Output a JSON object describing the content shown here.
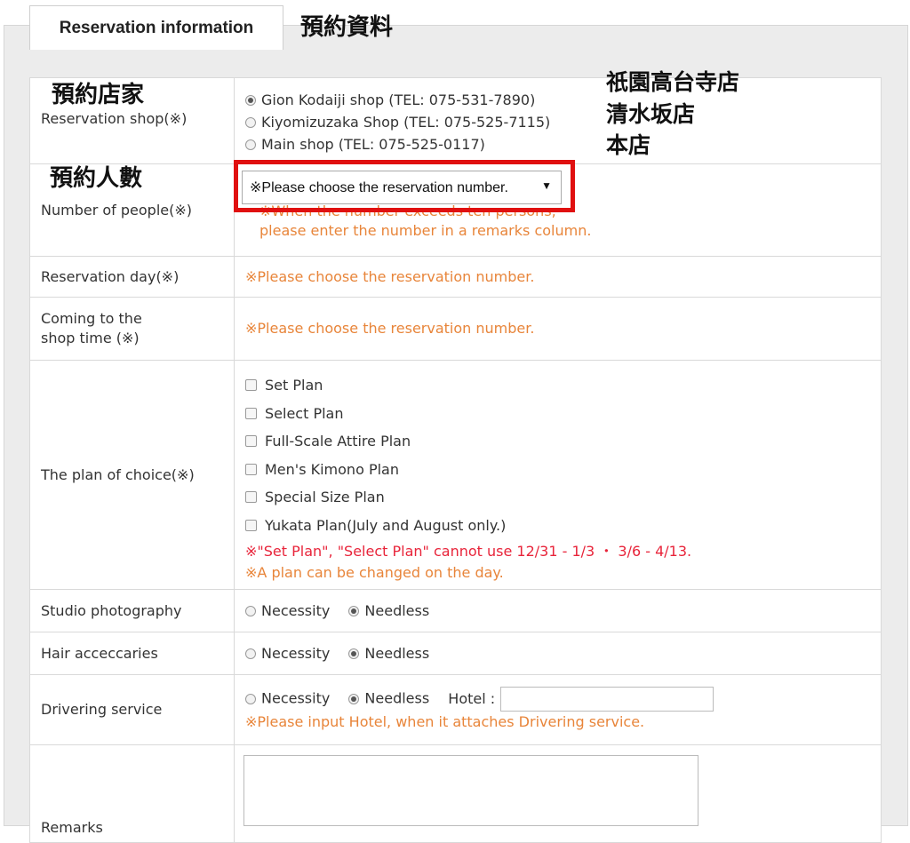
{
  "tab": {
    "label": "Reservation information",
    "cn": "預約資料"
  },
  "annotations": {
    "shop": "預約店家",
    "people": "預約人數",
    "shop_names": [
      "祇園高台寺店",
      "清水坂店",
      "本店"
    ]
  },
  "rows": {
    "shop": {
      "label": "Reservation shop(※)",
      "options": [
        {
          "text": "Gion Kodaiji shop (TEL: 075-531-7890)",
          "selected": true
        },
        {
          "text": "Kiyomizuzaka Shop (TEL: 075-525-7115)",
          "selected": false
        },
        {
          "text": "Main shop (TEL: 075-525-0117)",
          "selected": false
        }
      ]
    },
    "people": {
      "label": "Number of people(※)",
      "select_value": "※Please choose the reservation number.",
      "note1": "※When the number exceeds ten persons,",
      "note2": "please enter the number in a remarks column."
    },
    "day": {
      "label": "Reservation day(※)",
      "note": "※Please choose the reservation number."
    },
    "time": {
      "label1": "Coming to the",
      "label2": "shop time (※)",
      "note": "※Please choose the reservation number."
    },
    "plan": {
      "label": "The plan of choice(※)",
      "options": [
        "Set Plan",
        "Select Plan",
        "Full-Scale Attire Plan",
        "Men's Kimono Plan",
        "Special Size Plan",
        "Yukata Plan(July and August only.)"
      ],
      "note_red": "※\"Set Plan\", \"Select Plan\" cannot use 12/31 - 1/3 ・ 3/6 - 4/13.",
      "note_orange": "※A plan can be changed on the day."
    },
    "studio": {
      "label": "Studio photography",
      "opt1": "Necessity",
      "opt2": "Needless"
    },
    "hair": {
      "label": "Hair acceccaries",
      "opt1": "Necessity",
      "opt2": "Needless"
    },
    "driver": {
      "label": "Drivering service",
      "opt1": "Necessity",
      "opt2": "Needless",
      "hotel_label": "Hotel :",
      "note": "※Please input Hotel, when it attaches Drivering service."
    },
    "remarks": {
      "label": "Remarks"
    }
  },
  "colors": {
    "highlight": "#e01010",
    "note_orange": "#e8853a",
    "note_red": "#e8243a"
  }
}
